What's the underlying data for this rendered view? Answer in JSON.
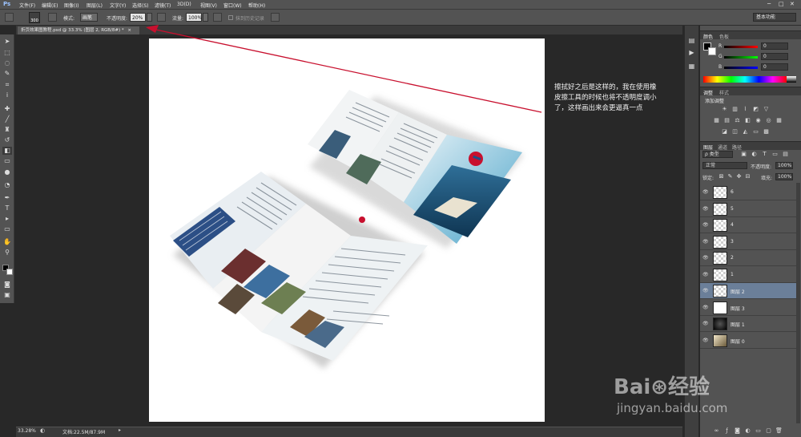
{
  "app": {
    "logo": "Ps"
  },
  "menu": [
    "文件(F)",
    "编辑(E)",
    "图像(I)",
    "图层(L)",
    "文字(Y)",
    "选择(S)",
    "滤镜(T)",
    "3D(D)",
    "视图(V)",
    "窗口(W)",
    "帮助(H)"
  ],
  "options": {
    "brush_size": "300",
    "mode_label": "模式:",
    "mode_value": "画笔",
    "opacity_label": "不透明度:",
    "opacity_value": "20%",
    "flow_label": "流量:",
    "flow_value": "100%",
    "history_label": "抹到历史记录",
    "workspace": "基本功能"
  },
  "document": {
    "tab_title": "折页效果图教程.psd @ 33.3% (图层 2, RGB/8#) *",
    "close": "×"
  },
  "annotation": "擦拭好之后是这样的，我在使用橡皮擦工具的时候也将不透明度调小了，这样画出来会更逼真一点",
  "status": {
    "zoom": "33.28%",
    "doc_size": "文档:22.5M/87.9M"
  },
  "color_panel": {
    "tabs": [
      "颜色",
      "色板"
    ],
    "channels": [
      {
        "label": "R",
        "value": "0",
        "color": "#cc3333"
      },
      {
        "label": "G",
        "value": "0",
        "color": "#33aa33"
      },
      {
        "label": "B",
        "value": "0",
        "color": "#3344cc"
      }
    ]
  },
  "adjust_panel": {
    "tabs": [
      "调整",
      "样式"
    ],
    "title": "添加调整",
    "icons": [
      "brightness-icon",
      "levels-icon",
      "curves-icon",
      "exposure-icon",
      "triangle-icon",
      "vibrance-icon",
      "hue-icon",
      "balance-icon",
      "bw-icon",
      "photo-filter-icon",
      "mixer-icon",
      "lookup-icon",
      "invert-icon",
      "posterize-icon",
      "threshold-icon",
      "gradient-map-icon",
      "selective-color-icon"
    ]
  },
  "layers_panel": {
    "tabs": [
      "图层",
      "通道",
      "路径"
    ],
    "filter_label": "ρ 类型",
    "blend_mode": "正常",
    "opacity_label": "不透明度:",
    "opacity_value": "100%",
    "lock_label": "锁定:",
    "fill_label": "填充:",
    "fill_value": "100%",
    "layers": [
      {
        "name": "6",
        "thumb": "trans",
        "selected": false
      },
      {
        "name": "5",
        "thumb": "trans",
        "selected": false
      },
      {
        "name": "4",
        "thumb": "trans",
        "selected": false
      },
      {
        "name": "3",
        "thumb": "trans",
        "selected": false
      },
      {
        "name": "2",
        "thumb": "trans",
        "selected": false
      },
      {
        "name": "1",
        "thumb": "trans",
        "selected": false
      },
      {
        "name": "图层 2",
        "thumb": "trans",
        "selected": true
      },
      {
        "name": "图层 3",
        "thumb": "white",
        "selected": false
      },
      {
        "name": "图层 1",
        "thumb": "dark",
        "selected": false
      },
      {
        "name": "图层 0",
        "thumb": "photo",
        "selected": false
      }
    ]
  },
  "watermark": {
    "brand": "Bai⊛经验",
    "url": "jingyan.baidu.com"
  },
  "colors": {
    "accent": "#c8102e",
    "selected_layer": "#6b7f99",
    "panel": "#535353",
    "workspace_bg": "#282828"
  }
}
